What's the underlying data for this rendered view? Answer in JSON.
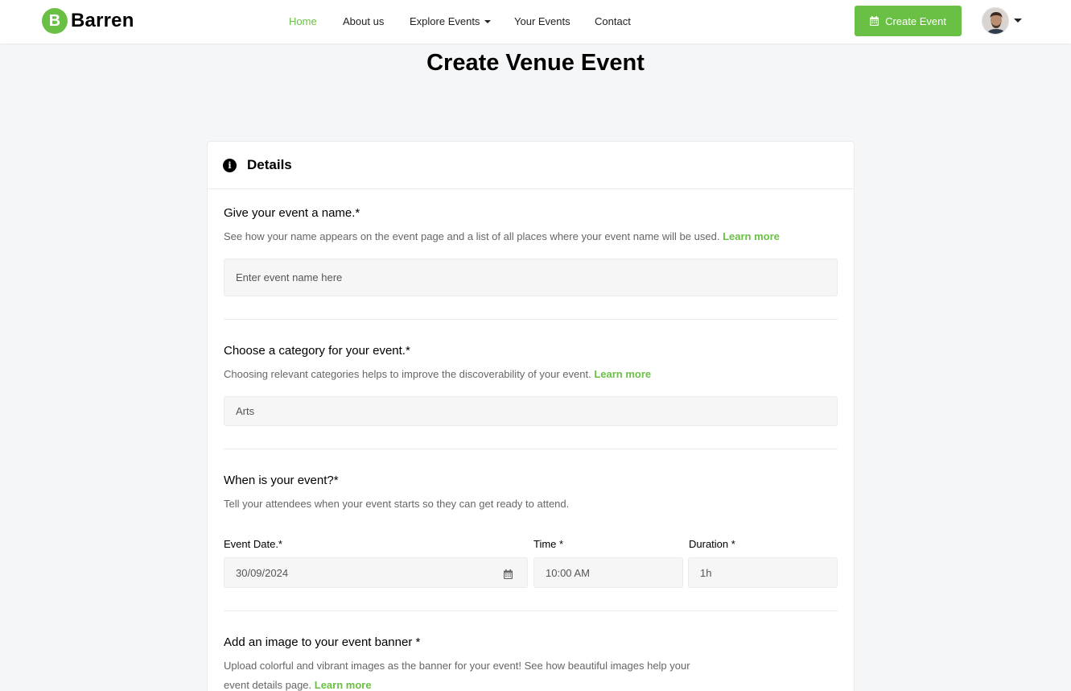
{
  "header": {
    "logo_letter": "B",
    "logo_text": "Barren",
    "nav": [
      {
        "label": "Home",
        "active": true
      },
      {
        "label": "About us",
        "active": false
      },
      {
        "label": "Explore Events",
        "active": false,
        "dropdown": true
      },
      {
        "label": "Your Events",
        "active": false
      },
      {
        "label": "Contact",
        "active": false
      }
    ],
    "create_button": "Create Event",
    "accent_color": "#6ac045"
  },
  "page_title": "Create Venue Event",
  "card": {
    "title": "Details",
    "name_section": {
      "title": "Give your event a name.*",
      "desc": "See how your name appears on the event page and a list of all places where your event name will be used.",
      "learn_more": "Learn more",
      "placeholder": "Enter event name here"
    },
    "category_section": {
      "title": "Choose a category for your event.*",
      "desc": "Choosing relevant categories helps to improve the discoverability of your event.",
      "learn_more": "Learn more",
      "selected": "Arts"
    },
    "when_section": {
      "title": "When is your event?*",
      "desc": "Tell your attendees when your event starts so they can get ready to attend.",
      "date_label": "Event Date.*",
      "date_value": "30/09/2024",
      "time_label": "Time *",
      "time_value": "10:00 AM",
      "duration_label": "Duration *",
      "duration_value": "1h"
    },
    "banner_section": {
      "title": "Add an image to your event banner *",
      "desc_line1": "Upload colorful and vibrant images as the banner for your event! See how beautiful images help your",
      "desc_line2": "event details page.",
      "learn_more": "Learn more"
    }
  }
}
